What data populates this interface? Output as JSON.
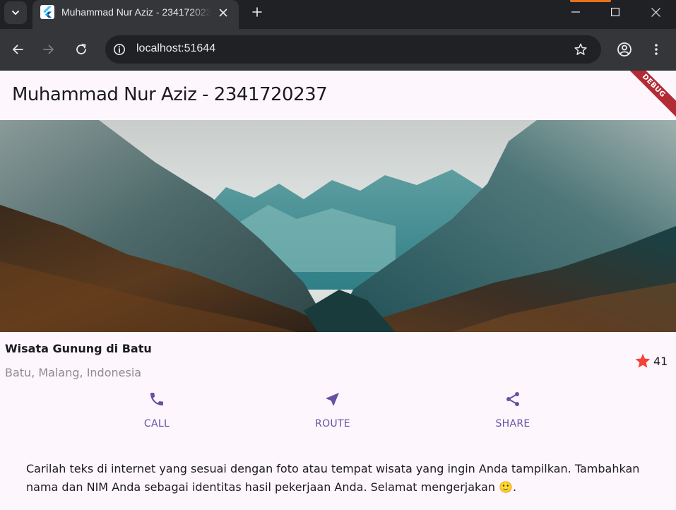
{
  "browser": {
    "tab_title": "Muhammad Nur Aziz - 2341720237",
    "url": "localhost:51644"
  },
  "app": {
    "title": "Muhammad Nur Aziz - 2341720237",
    "debug_banner": "DEBUG",
    "place_name": "Wisata Gunung di Batu",
    "location": "Batu, Malang, Indonesia",
    "rating_count": "41",
    "actions": [
      {
        "label": "CALL",
        "icon": "phone-icon"
      },
      {
        "label": "ROUTE",
        "icon": "navigation-icon"
      },
      {
        "label": "SHARE",
        "icon": "share-icon"
      }
    ],
    "description": "Carilah teks di internet yang sesuai dengan foto atau tempat wisata yang ingin Anda tampilkan. Tambahkan nama dan NIM Anda sebagai identitas hasil pekerjaan Anda. Selamat mengerjakan 🙂."
  },
  "colors": {
    "accent": "#6750a4",
    "star": "#f44336",
    "background": "#fdf7fd"
  }
}
